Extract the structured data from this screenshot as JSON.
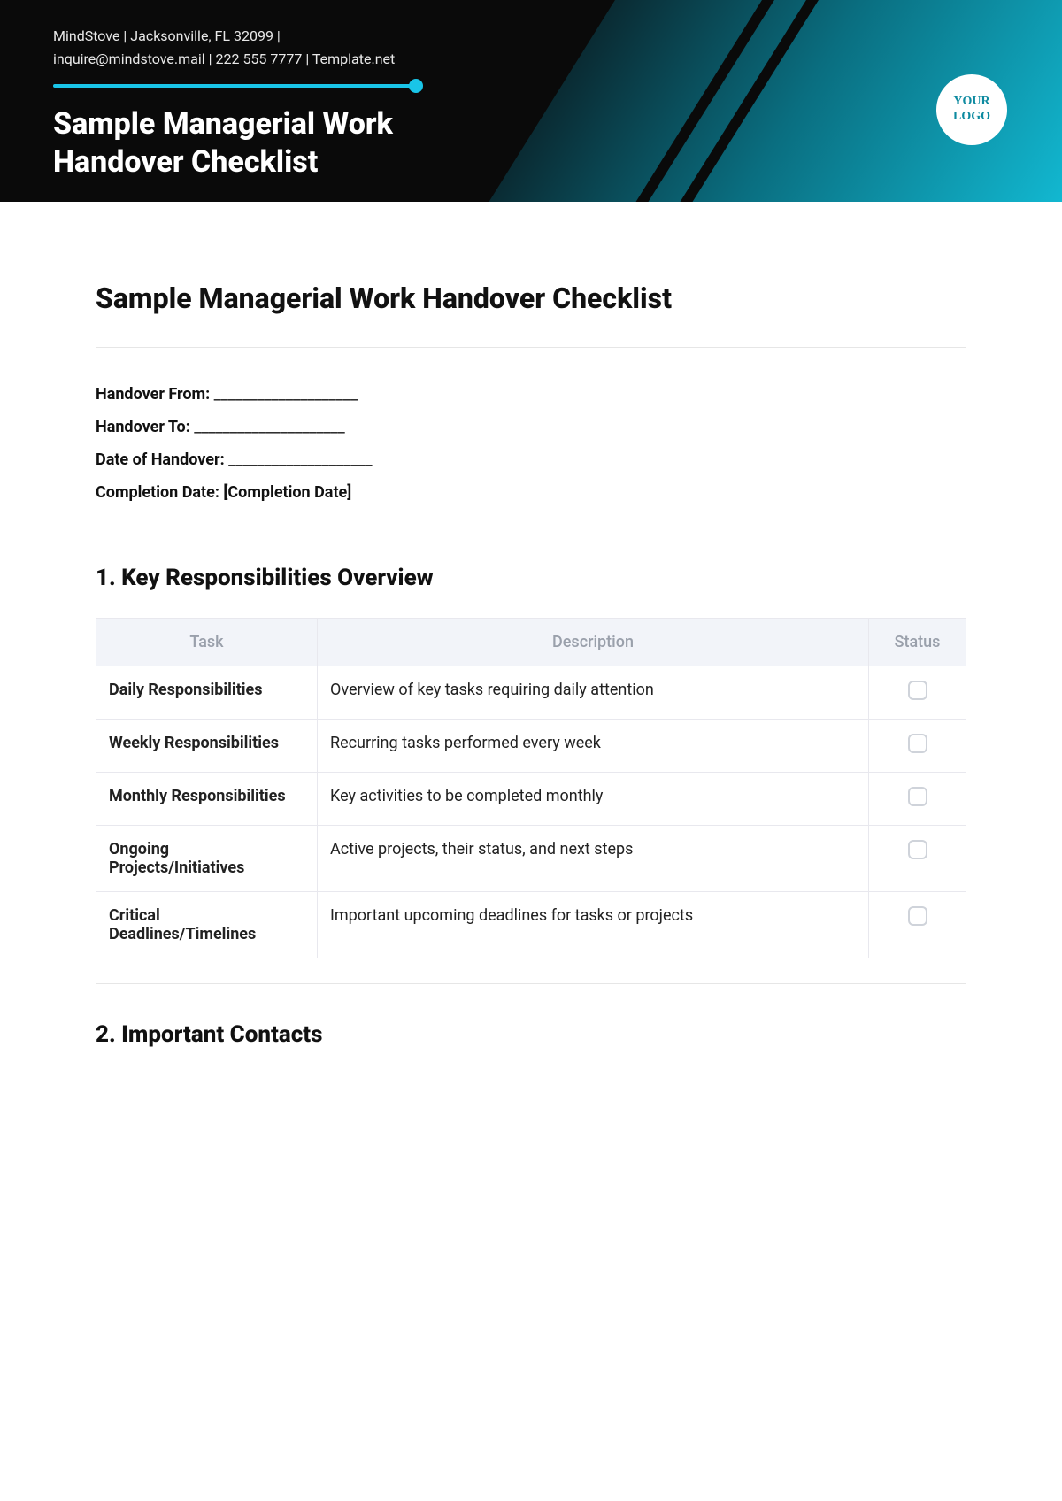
{
  "header": {
    "company_line1": "MindStove | Jacksonville, FL 32099 |",
    "company_line2": "inquire@mindstove.mail | 222 555 7777 | Template.net",
    "title_line1": "Sample Managerial Work",
    "title_line2": "Handover Checklist",
    "logo_line1": "YOUR",
    "logo_line2": "LOGO"
  },
  "doc": {
    "title": "Sample Managerial Work Handover Checklist"
  },
  "fields": {
    "from_label": "Handover From:",
    "from_blank": " ____________________",
    "to_label": "Handover To:",
    "to_blank": " _____________________",
    "date_label": "Date of Handover:",
    "date_blank": " ____________________",
    "completion_label": "Completion Date:",
    "completion_value": " [Completion Date]"
  },
  "section1": {
    "heading": "1. Key Responsibilities Overview",
    "col_task": "Task",
    "col_desc": "Description",
    "col_status": "Status",
    "rows": [
      {
        "task": "Daily Responsibilities",
        "desc": "Overview of key tasks requiring daily attention"
      },
      {
        "task": "Weekly Responsibilities",
        "desc": "Recurring tasks performed every week"
      },
      {
        "task": "Monthly Responsibilities",
        "desc": "Key activities to be completed monthly"
      },
      {
        "task": "Ongoing Projects/Initiatives",
        "desc": "Active projects, their status, and next steps"
      },
      {
        "task": "Critical Deadlines/Timelines",
        "desc": "Important upcoming deadlines for tasks or projects"
      }
    ]
  },
  "section2": {
    "heading": "2. Important Contacts"
  }
}
